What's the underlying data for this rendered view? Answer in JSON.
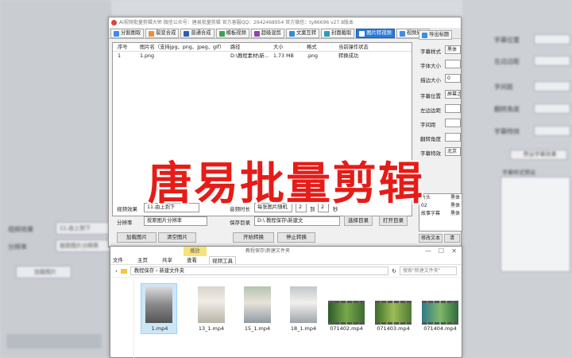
{
  "overlay_title": "唐易批量剪辑",
  "app": {
    "title": "AI视频批量剪辑大师  微信公众号：唐易批量剪辑  官方客服QQ：2642468954  官方微信：ty86696   v27.8版本",
    "toolbar": [
      "分割图取",
      "裂变合成",
      "普通合成",
      "模板视频",
      "超级混剪",
      "文案互转",
      "封面截取",
      "图片转视频",
      "视频处理",
      "导出标题"
    ],
    "grid_headers": [
      "序号",
      "图片名（支持jpg、png、jpeg、gif）",
      "路径",
      "大小",
      "格式",
      "当前操作状态"
    ],
    "grid_rows": [
      [
        "1",
        "1.png",
        "D:\\教程素材\\新...",
        "1.73 MB",
        ".png",
        "转换成功"
      ]
    ],
    "right_panel": [
      {
        "label": "字幕样式",
        "value": "黑体"
      },
      {
        "label": "字体大小",
        "value": ""
      },
      {
        "label": "描边大小",
        "value": "0"
      },
      {
        "label": "字幕位置",
        "value": "屏幕之"
      },
      {
        "label": "左边边距",
        "value": ""
      },
      {
        "label": "字间距",
        "value": ""
      },
      {
        "label": "翻转角度",
        "value": ""
      },
      {
        "label": "字幕特效",
        "value": "北京"
      }
    ],
    "right_list": [
      "片头",
      "02",
      "故事字幕"
    ],
    "right_list_vals": [
      "黑体",
      "黑体",
      "黑体"
    ],
    "modify_btn": "修改文本",
    "clear_btn": "清",
    "bottom": {
      "effect_label": "视频效果",
      "effect_value": "11.由上到下",
      "duration_label": "音频时长",
      "duration_value": "每张图片随机",
      "from_value": "2",
      "to_label": "到",
      "to_value": "2",
      "sec_label": "秒",
      "res_label": "分辨率",
      "res_value": "按原图片分辨率",
      "save_label": "保存目录",
      "save_value": "D:\\         教程保存\\新建文",
      "choose_dir": "选择目录",
      "open_dir": "打开目录",
      "add_btn": "加载图片",
      "clear_img_btn": "清空图片",
      "start_btn": "开始转换",
      "stop_btn": "停止转换"
    }
  },
  "explorer": {
    "title": "教程保存\\新建文件夹",
    "play_tab": "播放",
    "ribbon": [
      "文件",
      "主页",
      "共享",
      "查看",
      "视频工具"
    ],
    "path": "教程保存 › 新建文件夹",
    "search": "搜索\"新建文件夹\"",
    "files": [
      "1.mp4",
      "13_1.mp4",
      "15_1.mp4",
      "18_1.mp4",
      "071402.mp4",
      "071403.mp4",
      "071404.mp4"
    ]
  },
  "background": {
    "left_rows": [
      "11.由上到下",
      "按原图片分辨率",
      "加载图片"
    ],
    "left_labels": [
      "视频效果",
      "分辨率"
    ],
    "right_labels": [
      "字幕位置",
      "左边边距",
      "字间距",
      "翻转角度",
      "字幕特效"
    ],
    "right_btn": "贺设字幕效果",
    "right_list_title": "字幕样式预设"
  }
}
